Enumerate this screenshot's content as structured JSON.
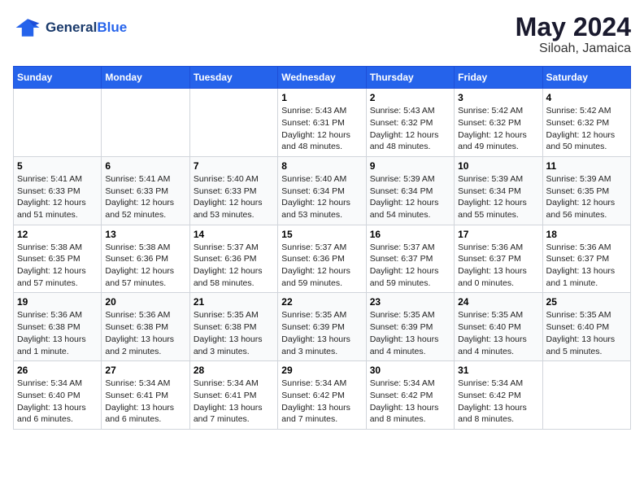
{
  "header": {
    "logo_line1": "General",
    "logo_line2": "Blue",
    "month": "May 2024",
    "location": "Siloah, Jamaica"
  },
  "weekdays": [
    "Sunday",
    "Monday",
    "Tuesday",
    "Wednesday",
    "Thursday",
    "Friday",
    "Saturday"
  ],
  "weeks": [
    [
      {
        "day": "",
        "info": ""
      },
      {
        "day": "",
        "info": ""
      },
      {
        "day": "",
        "info": ""
      },
      {
        "day": "1",
        "info": "Sunrise: 5:43 AM\nSunset: 6:31 PM\nDaylight: 12 hours\nand 48 minutes."
      },
      {
        "day": "2",
        "info": "Sunrise: 5:43 AM\nSunset: 6:32 PM\nDaylight: 12 hours\nand 48 minutes."
      },
      {
        "day": "3",
        "info": "Sunrise: 5:42 AM\nSunset: 6:32 PM\nDaylight: 12 hours\nand 49 minutes."
      },
      {
        "day": "4",
        "info": "Sunrise: 5:42 AM\nSunset: 6:32 PM\nDaylight: 12 hours\nand 50 minutes."
      }
    ],
    [
      {
        "day": "5",
        "info": "Sunrise: 5:41 AM\nSunset: 6:33 PM\nDaylight: 12 hours\nand 51 minutes."
      },
      {
        "day": "6",
        "info": "Sunrise: 5:41 AM\nSunset: 6:33 PM\nDaylight: 12 hours\nand 52 minutes."
      },
      {
        "day": "7",
        "info": "Sunrise: 5:40 AM\nSunset: 6:33 PM\nDaylight: 12 hours\nand 53 minutes."
      },
      {
        "day": "8",
        "info": "Sunrise: 5:40 AM\nSunset: 6:34 PM\nDaylight: 12 hours\nand 53 minutes."
      },
      {
        "day": "9",
        "info": "Sunrise: 5:39 AM\nSunset: 6:34 PM\nDaylight: 12 hours\nand 54 minutes."
      },
      {
        "day": "10",
        "info": "Sunrise: 5:39 AM\nSunset: 6:34 PM\nDaylight: 12 hours\nand 55 minutes."
      },
      {
        "day": "11",
        "info": "Sunrise: 5:39 AM\nSunset: 6:35 PM\nDaylight: 12 hours\nand 56 minutes."
      }
    ],
    [
      {
        "day": "12",
        "info": "Sunrise: 5:38 AM\nSunset: 6:35 PM\nDaylight: 12 hours\nand 57 minutes."
      },
      {
        "day": "13",
        "info": "Sunrise: 5:38 AM\nSunset: 6:36 PM\nDaylight: 12 hours\nand 57 minutes."
      },
      {
        "day": "14",
        "info": "Sunrise: 5:37 AM\nSunset: 6:36 PM\nDaylight: 12 hours\nand 58 minutes."
      },
      {
        "day": "15",
        "info": "Sunrise: 5:37 AM\nSunset: 6:36 PM\nDaylight: 12 hours\nand 59 minutes."
      },
      {
        "day": "16",
        "info": "Sunrise: 5:37 AM\nSunset: 6:37 PM\nDaylight: 12 hours\nand 59 minutes."
      },
      {
        "day": "17",
        "info": "Sunrise: 5:36 AM\nSunset: 6:37 PM\nDaylight: 13 hours\nand 0 minutes."
      },
      {
        "day": "18",
        "info": "Sunrise: 5:36 AM\nSunset: 6:37 PM\nDaylight: 13 hours\nand 1 minute."
      }
    ],
    [
      {
        "day": "19",
        "info": "Sunrise: 5:36 AM\nSunset: 6:38 PM\nDaylight: 13 hours\nand 1 minute."
      },
      {
        "day": "20",
        "info": "Sunrise: 5:36 AM\nSunset: 6:38 PM\nDaylight: 13 hours\nand 2 minutes."
      },
      {
        "day": "21",
        "info": "Sunrise: 5:35 AM\nSunset: 6:38 PM\nDaylight: 13 hours\nand 3 minutes."
      },
      {
        "day": "22",
        "info": "Sunrise: 5:35 AM\nSunset: 6:39 PM\nDaylight: 13 hours\nand 3 minutes."
      },
      {
        "day": "23",
        "info": "Sunrise: 5:35 AM\nSunset: 6:39 PM\nDaylight: 13 hours\nand 4 minutes."
      },
      {
        "day": "24",
        "info": "Sunrise: 5:35 AM\nSunset: 6:40 PM\nDaylight: 13 hours\nand 4 minutes."
      },
      {
        "day": "25",
        "info": "Sunrise: 5:35 AM\nSunset: 6:40 PM\nDaylight: 13 hours\nand 5 minutes."
      }
    ],
    [
      {
        "day": "26",
        "info": "Sunrise: 5:34 AM\nSunset: 6:40 PM\nDaylight: 13 hours\nand 6 minutes."
      },
      {
        "day": "27",
        "info": "Sunrise: 5:34 AM\nSunset: 6:41 PM\nDaylight: 13 hours\nand 6 minutes."
      },
      {
        "day": "28",
        "info": "Sunrise: 5:34 AM\nSunset: 6:41 PM\nDaylight: 13 hours\nand 7 minutes."
      },
      {
        "day": "29",
        "info": "Sunrise: 5:34 AM\nSunset: 6:42 PM\nDaylight: 13 hours\nand 7 minutes."
      },
      {
        "day": "30",
        "info": "Sunrise: 5:34 AM\nSunset: 6:42 PM\nDaylight: 13 hours\nand 8 minutes."
      },
      {
        "day": "31",
        "info": "Sunrise: 5:34 AM\nSunset: 6:42 PM\nDaylight: 13 hours\nand 8 minutes."
      },
      {
        "day": "",
        "info": ""
      }
    ]
  ]
}
